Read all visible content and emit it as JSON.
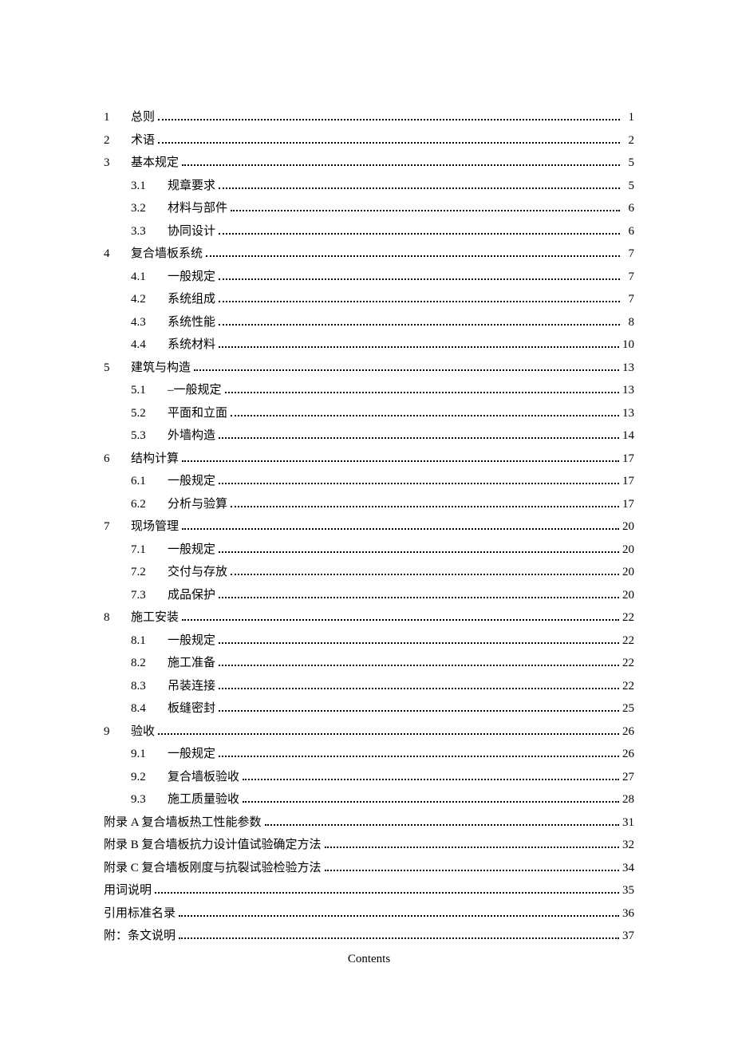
{
  "chapters": [
    {
      "num": "1",
      "title": "总则",
      "page": "1",
      "sections": []
    },
    {
      "num": "2",
      "title": "术语",
      "page": "2",
      "sections": []
    },
    {
      "num": "3",
      "title": "基本规定",
      "page": "5",
      "sections": [
        {
          "num": "3.1",
          "title": "规章要求",
          "page": "5"
        },
        {
          "num": "3.2",
          "title": "材料与部件",
          "page": "6"
        },
        {
          "num": "3.3",
          "title": "协同设计",
          "page": "6"
        }
      ]
    },
    {
      "num": "4",
      "title": "复合墙板系统",
      "page": "7",
      "sections": [
        {
          "num": "4.1",
          "title": "一般规定",
          "page": "7"
        },
        {
          "num": "4.2",
          "title": "系统组成",
          "page": "7"
        },
        {
          "num": "4.3",
          "title": "系统性能",
          "page": "8"
        },
        {
          "num": "4.4",
          "title": "系统材料",
          "page": "10"
        }
      ]
    },
    {
      "num": "5",
      "title": "建筑与构造",
      "page": "13",
      "sections": [
        {
          "num": "5.1",
          "title": "–一般规定",
          "page": "13"
        },
        {
          "num": "5.2",
          "title": "平面和立面",
          "page": "13"
        },
        {
          "num": "5.3",
          "title": "外墙构造",
          "page": "14"
        }
      ]
    },
    {
      "num": "6",
      "title": "结构计算",
      "page": "17",
      "sections": [
        {
          "num": "6.1",
          "title": "一般规定",
          "page": "17"
        },
        {
          "num": "6.2",
          "title": "分析与验算",
          "page": "17"
        }
      ]
    },
    {
      "num": "7",
      "title": "现场管理",
      "page": "20",
      "sections": [
        {
          "num": "7.1",
          "title": "一般规定",
          "page": "20"
        },
        {
          "num": "7.2",
          "title": "交付与存放",
          "page": "20"
        },
        {
          "num": "7.3",
          "title": "成品保护",
          "page": "20"
        }
      ]
    },
    {
      "num": "8",
      "title": "施工安装",
      "page": "22",
      "sections": [
        {
          "num": "8.1",
          "title": "一般规定",
          "page": "22"
        },
        {
          "num": "8.2",
          "title": "施工准备",
          "page": "22"
        },
        {
          "num": "8.3",
          "title": "吊装连接",
          "page": "22"
        },
        {
          "num": "8.4",
          "title": "板缝密封",
          "page": "25"
        }
      ]
    },
    {
      "num": "9",
      "title": "验收",
      "page": "26",
      "sections": [
        {
          "num": "9.1",
          "title": "一般规定",
          "page": "26"
        },
        {
          "num": "9.2",
          "title": "复合墙板验收",
          "page": "27"
        },
        {
          "num": "9.3",
          "title": "施工质量验收",
          "page": "28"
        }
      ]
    }
  ],
  "appendices": [
    {
      "title": "附录 A 复合墙板热工性能参数",
      "page": "31"
    },
    {
      "title": "附录 B 复合墙板抗力设计值试验确定方法",
      "page": "32"
    },
    {
      "title": "附录 C 复合墙板刚度与抗裂试验检验方法",
      "page": "34"
    },
    {
      "title": "用词说明",
      "page": "35"
    },
    {
      "title": "引用标准名录",
      "page": "36"
    },
    {
      "title": "附：条文说明",
      "page": "37"
    }
  ],
  "footer_label": "Contents"
}
